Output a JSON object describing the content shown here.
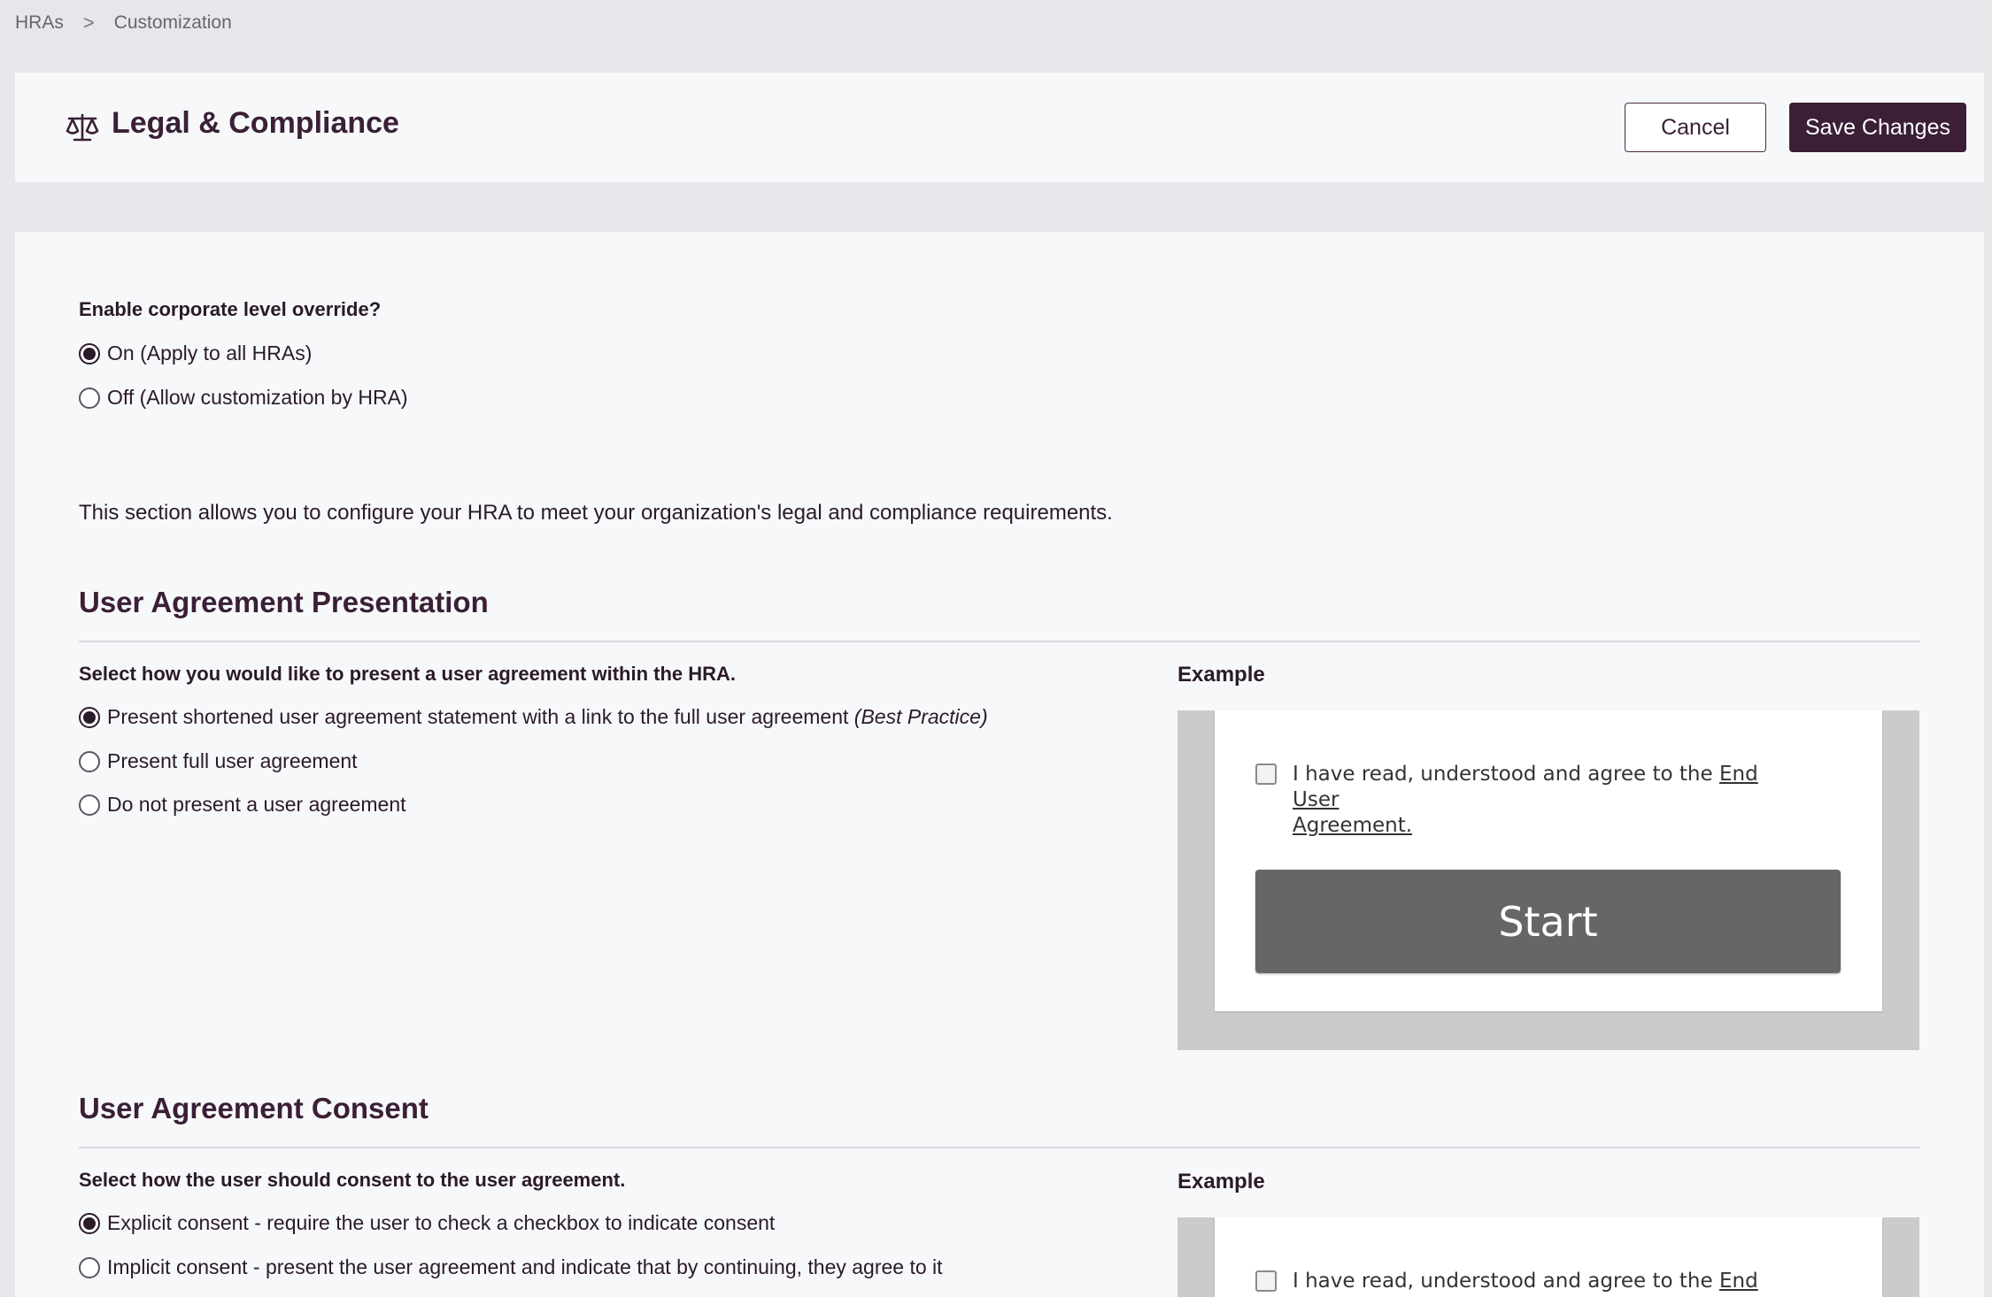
{
  "breadcrumb": {
    "root": "HRAs",
    "separator": ">",
    "current": "Customization"
  },
  "header": {
    "icon": "scales-icon",
    "title": "Legal & Compliance",
    "cancel_label": "Cancel",
    "save_label": "Save Changes"
  },
  "override": {
    "question": "Enable corporate level override?",
    "options": [
      {
        "label": "On (Apply to all HRAs)",
        "checked": true
      },
      {
        "label": "Off (Allow customization by HRA)",
        "checked": false
      }
    ]
  },
  "intro": "This section allows you to configure your HRA to meet your organization's legal and compliance requirements.",
  "presentation": {
    "title": "User Agreement Presentation",
    "prompt": "Select how you would like to present a user agreement within the HRA.",
    "options": [
      {
        "label": "Present shortened user agreement statement with a link to the full user agreement ",
        "emphasis": "(Best Practice)",
        "checked": true
      },
      {
        "label": "Present full user agreement",
        "checked": false
      },
      {
        "label": "Do not present a user agreement",
        "checked": false
      }
    ],
    "example_label": "Example",
    "example": {
      "text": "I have read, understood and agree to the ",
      "link": "End User Agreement",
      "link_part1": "End User",
      "link_part2": "Agreement",
      "period": ".",
      "button": "Start"
    }
  },
  "consent": {
    "title": "User Agreement Consent",
    "prompt": "Select how the user should consent to the user agreement.",
    "options": [
      {
        "label": "Explicit consent - require the user to check a checkbox to indicate consent",
        "checked": true
      },
      {
        "label": "Implicit consent - present the user agreement and indicate that by continuing, they agree to it",
        "checked": false
      }
    ],
    "example_label": "Example",
    "example": {
      "text": "I have read, understood and agree to the ",
      "link_part1": "End User"
    }
  },
  "colors": {
    "brand": "#3a1f36",
    "page_bg": "#e6e7ea",
    "card_bg": "#f7f8fa"
  }
}
